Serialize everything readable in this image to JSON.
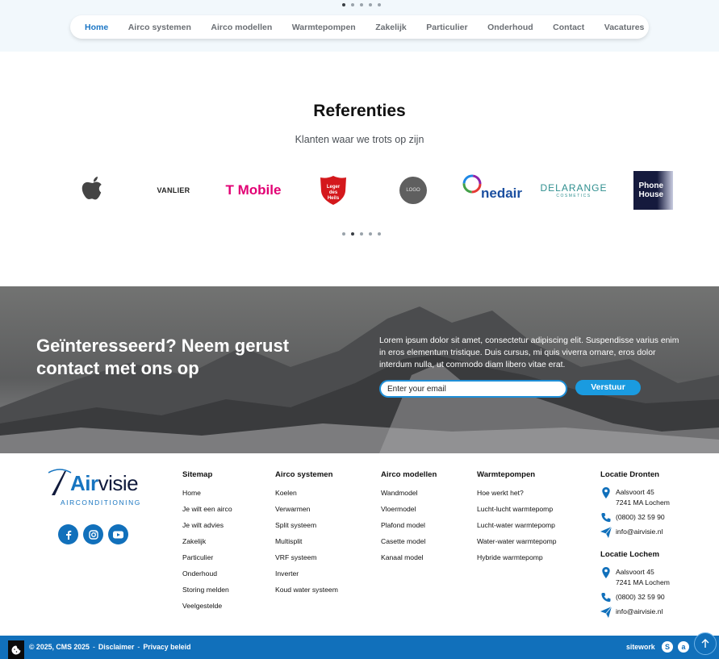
{
  "nav": {
    "items": [
      {
        "label": "Home",
        "active": true
      },
      {
        "label": "Airco systemen",
        "active": false
      },
      {
        "label": "Airco modellen",
        "active": false
      },
      {
        "label": "Warmtepompen",
        "active": false
      },
      {
        "label": "Zakelijk",
        "active": false
      },
      {
        "label": "Particulier",
        "active": false
      },
      {
        "label": "Onderhoud",
        "active": false
      },
      {
        "label": "Contact",
        "active": false
      },
      {
        "label": "Vacatures",
        "active": false
      }
    ],
    "carousel_dots": 5,
    "carousel_active_index": 0
  },
  "references": {
    "title": "Referenties",
    "subtitle": "Klanten waar we trots op zijn",
    "logos": [
      {
        "name": "apple-logo",
        "text": ""
      },
      {
        "name": "vanlier-logo",
        "text": "VANLIER"
      },
      {
        "name": "t-mobile-logo",
        "text": "T Mobile"
      },
      {
        "name": "leger-des-heils-logo",
        "text": "Leger des Heils"
      },
      {
        "name": "placeholder-logo",
        "text": "LOGO"
      },
      {
        "name": "nedair-logo",
        "text": "nedair"
      },
      {
        "name": "delarange-logo",
        "text": "DELARANGE",
        "subtext": "COSMETICS"
      },
      {
        "name": "phone-house-logo",
        "text": "Phone House"
      }
    ],
    "carousel_dots": 5,
    "carousel_active_index": 1
  },
  "cta": {
    "title": "Geïnteresseerd? Neem gerust contact met ons op",
    "text": "Lorem ipsum dolor sit amet, consectetur adipiscing elit. Suspendisse varius enim in eros elementum tristique. Duis cursus, mi quis viverra ornare, eros dolor interdum nulla, ut commodo diam libero vitae erat.",
    "email_placeholder": "Enter your email",
    "button_label": "Verstuur"
  },
  "footer": {
    "brand": {
      "name_prefix": "A",
      "name_bold": "ir",
      "name_rest": "visie",
      "tagline": "AIRCONDITIONING"
    },
    "social": [
      "facebook-icon",
      "instagram-icon",
      "youtube-icon"
    ],
    "columns": [
      {
        "title": "Sitemap",
        "links": [
          "Home",
          "Je wilt een airco",
          "Je wilt advies",
          "Zakelijk",
          "Particulier",
          "Onderhoud",
          "Storing melden",
          "Veelgestelde"
        ]
      },
      {
        "title": "Airco systemen",
        "links": [
          "Koelen",
          "Verwarmen",
          "Split systeem",
          "Multisplit",
          "VRF systeem",
          "Inverter",
          "Koud water systeem"
        ]
      },
      {
        "title": "Airco modellen",
        "links": [
          "Wandmodel",
          "Vloermodel",
          "Plafond model",
          "Casette model",
          "Kanaal model"
        ]
      },
      {
        "title": "Warmtepompen",
        "links": [
          "Hoe werkt het?",
          "Lucht-lucht warmtepomp",
          "Lucht-water warmtepomp",
          "Water-water warmtepomp",
          "Hybride warmtepomp"
        ]
      }
    ],
    "locations": [
      {
        "title": "Locatie Dronten",
        "address_line1": "Aalsvoort 45",
        "address_line2": "7241 MA Lochem",
        "phone": "(0800) 32 59 90",
        "email": "info@airvisie.nl"
      },
      {
        "title": "Locatie Lochem",
        "address_line1": "Aalsvoort 45",
        "address_line2": "7241 MA Lochem",
        "phone": "(0800) 32 59 90",
        "email": "info@airvisie.nl"
      }
    ]
  },
  "bottom": {
    "copyright": "© 2025, CMS 2025",
    "separator": "-",
    "disclaimer": "Disclaimer",
    "privacy": "Privacy beleid",
    "sitework": "sitework"
  },
  "colors": {
    "primary": "#1170bb",
    "accent": "#1a9be0",
    "nav_active": "#1b76c5",
    "tmobile": "#e20074"
  }
}
